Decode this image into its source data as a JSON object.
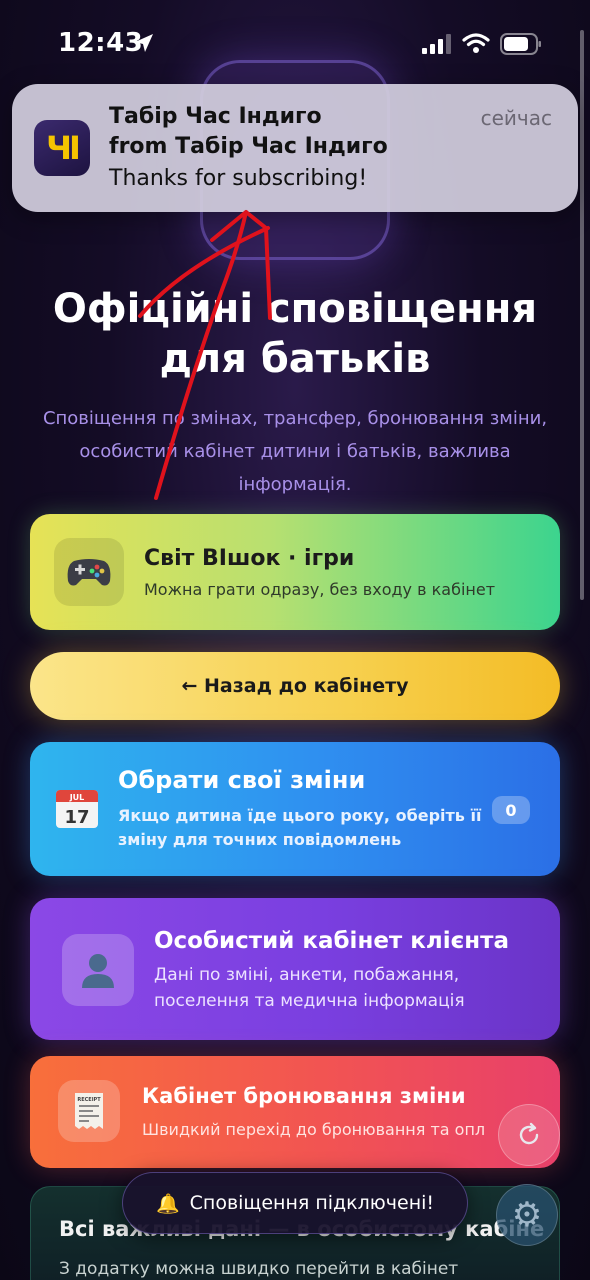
{
  "status_bar": {
    "time": "12:43",
    "icons": [
      "location-arrow-icon",
      "cellular-signal-icon",
      "wifi-icon",
      "battery-icon"
    ]
  },
  "notification": {
    "app_icon_text": "ЧІ",
    "title": "Табір Час Індиго",
    "from": "from Табір Час Індиго",
    "body": "Thanks for subscribing!",
    "time": "сейчас"
  },
  "hero": {
    "title_line1": "Офіційні сповіщення",
    "title_line2": "для батьків",
    "subtitle": "Сповіщення по змінах, трансфер, бронювання зміни, особистий кабінет дитини і батьків, важлива інформація."
  },
  "cards": {
    "games": {
      "icon": "gamepad-icon",
      "title": "Світ ВІшок · ігри",
      "desc": "Можна грати одразу, без входу в кабінет"
    },
    "back_button": "← Назад до кабінету",
    "shifts": {
      "icon": "calendar-icon",
      "title": "Обрати свої зміни",
      "desc": "Якщо дитина їде цього року, оберіть її зміну для точних повідомлень",
      "count": "0"
    },
    "cabinet": {
      "icon": "user-silhouette-icon",
      "title": "Особистий кабінет клієнта",
      "desc": "Дані по зміні, анкети, побажання, поселення та медична інформація"
    },
    "booking": {
      "icon": "receipt-icon",
      "title": "Кабінет бронювання зміни",
      "desc": "Швидкий перехід до бронювання та опл"
    },
    "info": {
      "title": "Всі важливі дані — в особистому кабіне",
      "desc": "З додатку можна швидко перейти в кабінет"
    }
  },
  "toast": {
    "icon": "bell-icon",
    "text": "Сповіщення підключені!"
  },
  "floating": {
    "refresh_icon": "refresh-icon",
    "settings_icon": "gear-icon"
  },
  "colors": {
    "background": "#140c26",
    "accent_purple": "#a890e8",
    "annotation_red": "#e0121c",
    "notif_bg": "#d2cdde"
  }
}
